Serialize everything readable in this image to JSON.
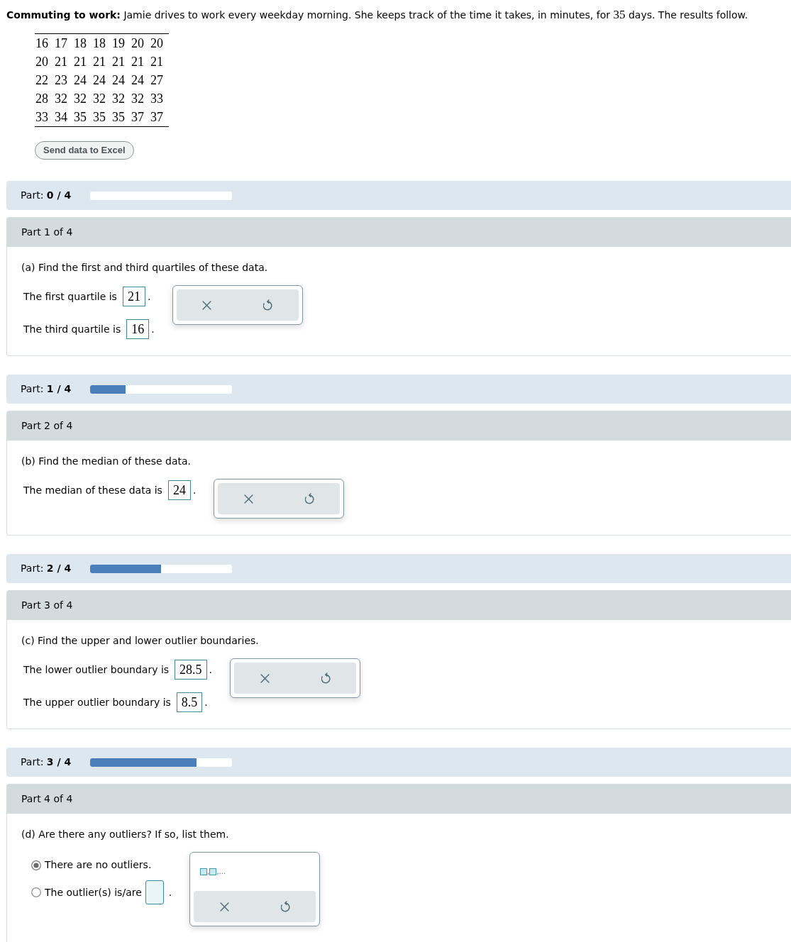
{
  "problem": {
    "lead": "Commuting to work:",
    "text": "Jamie drives to work every weekday morning. She keeps track of the time it takes, in minutes, for",
    "number": "35",
    "end": "days. The results follow."
  },
  "data_table": {
    "rows": [
      [
        "16",
        "17",
        "18",
        "18",
        "19",
        "20",
        "20"
      ],
      [
        "20",
        "21",
        "21",
        "21",
        "21",
        "21",
        "21"
      ],
      [
        "22",
        "23",
        "24",
        "24",
        "24",
        "24",
        "27"
      ],
      [
        "28",
        "32",
        "32",
        "32",
        "32",
        "32",
        "33"
      ],
      [
        "33",
        "34",
        "35",
        "35",
        "35",
        "37",
        "37"
      ]
    ]
  },
  "send_button": "Send data to Excel",
  "parts": [
    {
      "progress": {
        "label": "Part:",
        "count": "0 / 4"
      },
      "header": "Part 1 of 4",
      "question": "(a) Find the first and third quartiles of these data.",
      "kind": "fields",
      "answers": [
        {
          "label": "The first quartile is",
          "value": "21",
          "suffix": "."
        },
        {
          "label": "The third quartile is",
          "value": "16",
          "suffix": "."
        }
      ],
      "tools": {
        "buttons": [
          {
            "kind": "clear"
          },
          {
            "kind": "undo"
          }
        ]
      }
    },
    {
      "progress": {
        "label": "Part:",
        "count": "1 / 4",
        "level": 0.25
      },
      "header": "Part 2 of 4",
      "question": "(b) Find the median of these data.",
      "kind": "fields",
      "answers": [
        {
          "label": "The median of these data is",
          "value": "24",
          "suffix": "."
        }
      ],
      "tools": {
        "buttons": [
          {
            "kind": "clear"
          },
          {
            "kind": "undo"
          }
        ]
      }
    },
    {
      "progress": {
        "label": "Part:",
        "count": "2 / 4",
        "level": 0.5
      },
      "header": "Part 3 of 4",
      "question": "(c) Find the upper and lower outlier boundaries.",
      "kind": "fields",
      "answers": [
        {
          "label": "The lower outlier boundary is",
          "value": "28.5",
          "suffix": "."
        },
        {
          "label": "The upper outlier boundary is",
          "value": "8.5",
          "suffix": "."
        }
      ],
      "tools": {
        "buttons": [
          {
            "kind": "clear"
          },
          {
            "kind": "undo"
          }
        ]
      }
    },
    {
      "progress": {
        "label": "Part:",
        "count": "3 / 4",
        "level": 0.75
      },
      "header": "Part 4 of 4",
      "question": "(d) Are there any outliers? If so, list them.",
      "kind": "choice",
      "options": [
        {
          "kind": "text",
          "label": "There are no outliers.",
          "selected": true
        },
        {
          "kind": "field",
          "label": "The outlier(s) is/are",
          "selected": false,
          "suffix": "."
        }
      ],
      "tools": {
        "template": [
          ",",
          ",..."
        ],
        "buttons": [
          {
            "kind": "clear"
          },
          {
            "kind": "undo"
          }
        ]
      }
    }
  ]
}
